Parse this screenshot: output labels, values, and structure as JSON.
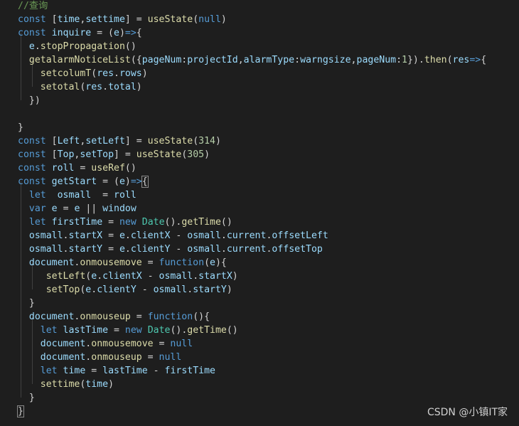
{
  "watermark": "CSDN @小镇IT家",
  "code_lines": [
    [
      [
        "cm",
        "//查询"
      ]
    ],
    [
      [
        "kw",
        "const"
      ],
      [
        "pl",
        " ["
      ],
      [
        "var",
        "time"
      ],
      [
        "pl",
        ","
      ],
      [
        "var",
        "settime"
      ],
      [
        "pl",
        "] = "
      ],
      [
        "fn",
        "useState"
      ],
      [
        "pl",
        "("
      ],
      [
        "kw",
        "null"
      ],
      [
        "pl",
        ")"
      ]
    ],
    [
      [
        "kw",
        "const"
      ],
      [
        "pl",
        " "
      ],
      [
        "var",
        "inquire"
      ],
      [
        "pl",
        " = ("
      ],
      [
        "var",
        "e"
      ],
      [
        "pl",
        ")"
      ],
      [
        "kw",
        "=>"
      ],
      [
        "pl",
        "{"
      ]
    ],
    [
      [
        "pl",
        "  "
      ],
      [
        "var",
        "e"
      ],
      [
        "pl",
        "."
      ],
      [
        "fn",
        "stopPropagation"
      ],
      [
        "pl",
        "()"
      ]
    ],
    [
      [
        "pl",
        "  "
      ],
      [
        "fn",
        "getalarmNoticeList"
      ],
      [
        "pl",
        "({"
      ],
      [
        "var",
        "pageNum"
      ],
      [
        "pl",
        ":"
      ],
      [
        "var",
        "projectId"
      ],
      [
        "pl",
        ","
      ],
      [
        "var",
        "alarmType"
      ],
      [
        "pl",
        ":"
      ],
      [
        "var",
        "warngsize"
      ],
      [
        "pl",
        ","
      ],
      [
        "var",
        "pageNum"
      ],
      [
        "pl",
        ":"
      ],
      [
        "num",
        "1"
      ],
      [
        "pl",
        "})."
      ],
      [
        "fn",
        "then"
      ],
      [
        "pl",
        "("
      ],
      [
        "var",
        "res"
      ],
      [
        "kw",
        "=>"
      ],
      [
        "pl",
        "{"
      ]
    ],
    [
      [
        "pl",
        "    "
      ],
      [
        "fn",
        "setcolumT"
      ],
      [
        "pl",
        "("
      ],
      [
        "var",
        "res"
      ],
      [
        "pl",
        "."
      ],
      [
        "var",
        "rows"
      ],
      [
        "pl",
        ")"
      ]
    ],
    [
      [
        "pl",
        "    "
      ],
      [
        "fn",
        "setotal"
      ],
      [
        "pl",
        "("
      ],
      [
        "var",
        "res"
      ],
      [
        "pl",
        "."
      ],
      [
        "var",
        "total"
      ],
      [
        "pl",
        ")"
      ]
    ],
    [
      [
        "pl",
        "  })"
      ]
    ],
    [],
    [
      [
        "pl",
        "}"
      ]
    ],
    [
      [
        "kw",
        "const"
      ],
      [
        "pl",
        " ["
      ],
      [
        "var",
        "Left"
      ],
      [
        "pl",
        ","
      ],
      [
        "var",
        "setLeft"
      ],
      [
        "pl",
        "] = "
      ],
      [
        "fn",
        "useState"
      ],
      [
        "pl",
        "("
      ],
      [
        "num",
        "314"
      ],
      [
        "pl",
        ")"
      ]
    ],
    [
      [
        "kw",
        "const"
      ],
      [
        "pl",
        " ["
      ],
      [
        "var",
        "Top"
      ],
      [
        "pl",
        ","
      ],
      [
        "var",
        "setTop"
      ],
      [
        "pl",
        "] = "
      ],
      [
        "fn",
        "useState"
      ],
      [
        "pl",
        "("
      ],
      [
        "num",
        "305"
      ],
      [
        "pl",
        ")"
      ]
    ],
    [
      [
        "kw",
        "const"
      ],
      [
        "pl",
        " "
      ],
      [
        "var",
        "roll"
      ],
      [
        "pl",
        " = "
      ],
      [
        "fn",
        "useRef"
      ],
      [
        "pl",
        "()"
      ]
    ],
    [
      [
        "kw",
        "const"
      ],
      [
        "pl",
        " "
      ],
      [
        "var",
        "getStart"
      ],
      [
        "pl",
        " = ("
      ],
      [
        "var",
        "e"
      ],
      [
        "pl",
        ")"
      ],
      [
        "kw",
        "=>"
      ],
      [
        "bk",
        "{"
      ]
    ],
    [
      [
        "pl",
        "  "
      ],
      [
        "kw",
        "let"
      ],
      [
        "pl",
        "  "
      ],
      [
        "var",
        "osmall"
      ],
      [
        "pl",
        "  = "
      ],
      [
        "var",
        "roll"
      ]
    ],
    [
      [
        "pl",
        "  "
      ],
      [
        "kw",
        "var"
      ],
      [
        "pl",
        " "
      ],
      [
        "var",
        "e"
      ],
      [
        "pl",
        " = "
      ],
      [
        "var",
        "e"
      ],
      [
        "pl",
        " || "
      ],
      [
        "var",
        "window"
      ]
    ],
    [
      [
        "pl",
        "  "
      ],
      [
        "kw",
        "let"
      ],
      [
        "pl",
        " "
      ],
      [
        "var",
        "firstTime"
      ],
      [
        "pl",
        " = "
      ],
      [
        "kw",
        "new"
      ],
      [
        "pl",
        " "
      ],
      [
        "type",
        "Date"
      ],
      [
        "pl",
        "()."
      ],
      [
        "fn",
        "getTime"
      ],
      [
        "pl",
        "()"
      ]
    ],
    [
      [
        "pl",
        "  "
      ],
      [
        "var",
        "osmall"
      ],
      [
        "pl",
        "."
      ],
      [
        "var",
        "startX"
      ],
      [
        "pl",
        " = "
      ],
      [
        "var",
        "e"
      ],
      [
        "pl",
        "."
      ],
      [
        "var",
        "clientX"
      ],
      [
        "pl",
        " - "
      ],
      [
        "var",
        "osmall"
      ],
      [
        "pl",
        "."
      ],
      [
        "var",
        "current"
      ],
      [
        "pl",
        "."
      ],
      [
        "var",
        "offsetLeft"
      ]
    ],
    [
      [
        "pl",
        "  "
      ],
      [
        "var",
        "osmall"
      ],
      [
        "pl",
        "."
      ],
      [
        "var",
        "startY"
      ],
      [
        "pl",
        " = "
      ],
      [
        "var",
        "e"
      ],
      [
        "pl",
        "."
      ],
      [
        "var",
        "clientY"
      ],
      [
        "pl",
        " - "
      ],
      [
        "var",
        "osmall"
      ],
      [
        "pl",
        "."
      ],
      [
        "var",
        "current"
      ],
      [
        "pl",
        "."
      ],
      [
        "var",
        "offsetTop"
      ]
    ],
    [
      [
        "pl",
        "  "
      ],
      [
        "var",
        "document"
      ],
      [
        "pl",
        "."
      ],
      [
        "fn",
        "onmousemove"
      ],
      [
        "pl",
        " = "
      ],
      [
        "kw",
        "function"
      ],
      [
        "pl",
        "("
      ],
      [
        "var",
        "e"
      ],
      [
        "pl",
        "){"
      ]
    ],
    [
      [
        "pl",
        "     "
      ],
      [
        "fn",
        "setLeft"
      ],
      [
        "pl",
        "("
      ],
      [
        "var",
        "e"
      ],
      [
        "pl",
        "."
      ],
      [
        "var",
        "clientX"
      ],
      [
        "pl",
        " - "
      ],
      [
        "var",
        "osmall"
      ],
      [
        "pl",
        "."
      ],
      [
        "var",
        "startX"
      ],
      [
        "pl",
        ")"
      ]
    ],
    [
      [
        "pl",
        "     "
      ],
      [
        "fn",
        "setTop"
      ],
      [
        "pl",
        "("
      ],
      [
        "var",
        "e"
      ],
      [
        "pl",
        "."
      ],
      [
        "var",
        "clientY"
      ],
      [
        "pl",
        " - "
      ],
      [
        "var",
        "osmall"
      ],
      [
        "pl",
        "."
      ],
      [
        "var",
        "startY"
      ],
      [
        "pl",
        ")"
      ]
    ],
    [
      [
        "pl",
        "  }"
      ]
    ],
    [
      [
        "pl",
        "  "
      ],
      [
        "var",
        "document"
      ],
      [
        "pl",
        "."
      ],
      [
        "fn",
        "onmouseup"
      ],
      [
        "pl",
        " = "
      ],
      [
        "kw",
        "function"
      ],
      [
        "pl",
        "(){"
      ]
    ],
    [
      [
        "pl",
        "    "
      ],
      [
        "kw",
        "let"
      ],
      [
        "pl",
        " "
      ],
      [
        "var",
        "lastTime"
      ],
      [
        "pl",
        " = "
      ],
      [
        "kw",
        "new"
      ],
      [
        "pl",
        " "
      ],
      [
        "type",
        "Date"
      ],
      [
        "pl",
        "()."
      ],
      [
        "fn",
        "getTime"
      ],
      [
        "pl",
        "()"
      ]
    ],
    [
      [
        "pl",
        "    "
      ],
      [
        "var",
        "document"
      ],
      [
        "pl",
        "."
      ],
      [
        "fn",
        "onmousemove"
      ],
      [
        "pl",
        " = "
      ],
      [
        "kw",
        "null"
      ]
    ],
    [
      [
        "pl",
        "    "
      ],
      [
        "var",
        "document"
      ],
      [
        "pl",
        "."
      ],
      [
        "fn",
        "onmouseup"
      ],
      [
        "pl",
        " = "
      ],
      [
        "kw",
        "null"
      ]
    ],
    [
      [
        "pl",
        "    "
      ],
      [
        "kw",
        "let"
      ],
      [
        "pl",
        " "
      ],
      [
        "var",
        "time"
      ],
      [
        "pl",
        " = "
      ],
      [
        "var",
        "lastTime"
      ],
      [
        "pl",
        " - "
      ],
      [
        "var",
        "firstTime"
      ]
    ],
    [
      [
        "pl",
        "    "
      ],
      [
        "fn",
        "settime"
      ],
      [
        "pl",
        "("
      ],
      [
        "var",
        "time"
      ],
      [
        "pl",
        ")"
      ]
    ],
    [
      [
        "pl",
        "  }"
      ]
    ],
    [
      [
        "bk",
        "}"
      ]
    ]
  ]
}
